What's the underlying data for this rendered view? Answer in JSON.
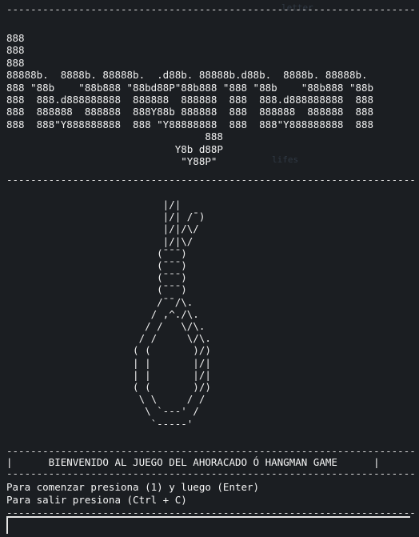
{
  "background_ghost": [
    "letter",
    "",
    "",
    "",
    "",
    "",
    "",
    "",
    "",
    "lifes",
    "",
    "",
    "",
    "",
    "",
    "",
    "",
    "",
    "",
    ""
  ],
  "terminal": {
    "rule_top": "--------------------------------------------------------------------",
    "title_art": "888\n888\n888\n88888b.  8888b. 88888b.  .d88b. 88888b.d88b.  8888b. 88888b.\n888 \"88b    \"88b888 \"88bd88P\"88b888 \"888 \"88b    \"88b888 \"88b\n888  888.d888888888  888888  888888  888  888.d888888888  888\n888  888888  888888  888Y88b 888888  888  888888  888888  888\n888  888\"Y888888888  888 \"Y88888888  888  888\"Y888888888  888\n                                 888\n                            Y8b d88P\n                             \"Y88P\"",
    "rule_mid": "--------------------------------------------------------------------",
    "gallows_art": "                          |/|\n                          |/| /¯)\n                          |/|/\\/\n                          |/|\\/\n                         (¯¯¯)\n                         (¯¯¯)\n                         (¯¯¯)\n                         (¯¯¯)\n                         /¯¯/\\.\n                        / ,^./\\.\n                       / /   \\/\\.\n                      / /     \\/\\.\n                     ( (       )/)\n                     | |       |/|\n                     | |       |/|\n                     ( (       )/)\n                      \\ \\     / /\n                       \\ `---' /\n                        `-----'",
    "rule_welcome_top": "--------------------------------------------------------------------",
    "welcome_text": "|      BIENVENIDO AL JUEGO DEL AHORACADO Ó HANGMAN GAME      |",
    "rule_welcome_bottom": "--------------------------------------------------------------------",
    "prompt_start": "Para comenzar presiona (1) y luego (Enter)",
    "prompt_exit": "Para salir presiona (Ctrl + C)",
    "rule_bottom": "--------------------------------------------------------------------"
  }
}
